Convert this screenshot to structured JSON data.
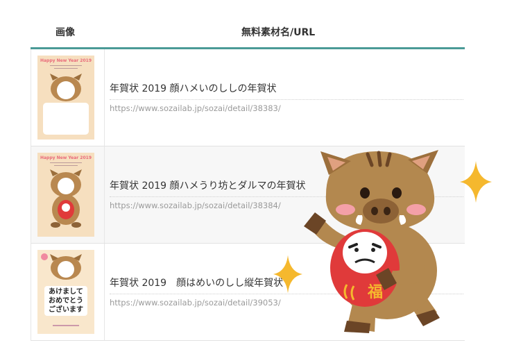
{
  "table": {
    "headers": {
      "image": "画像",
      "name_url": "無料素材名/URL"
    },
    "rows": [
      {
        "title": "年賀状 2019 顔ハメいのししの年賀状",
        "url": "https://www.sozailab.jp/sozai/detail/38383/",
        "thumb_title": "Happy New Year 2019"
      },
      {
        "title": "年賀状 2019 顔ハメうり坊とダルマの年賀状",
        "url": "https://www.sozailab.jp/sozai/detail/38384/",
        "thumb_title": "Happy New Year 2019"
      },
      {
        "title": "年賀状 2019　顔はめいのしし縦年賀状",
        "url": "https://www.sozailab.jp/sozai/detail/39053/",
        "thumb_message": "あけまして\nおめでとう\nございます"
      }
    ]
  },
  "mascot": {
    "daruma_text": "福"
  },
  "colors": {
    "header_border": "#4a9a96",
    "boar_brown": "#b3884f",
    "daruma_red": "#e03a3a",
    "sparkle": "#f5b82e"
  },
  "icons": [
    "sparkle-icon",
    "boar-mascot-illustration"
  ]
}
